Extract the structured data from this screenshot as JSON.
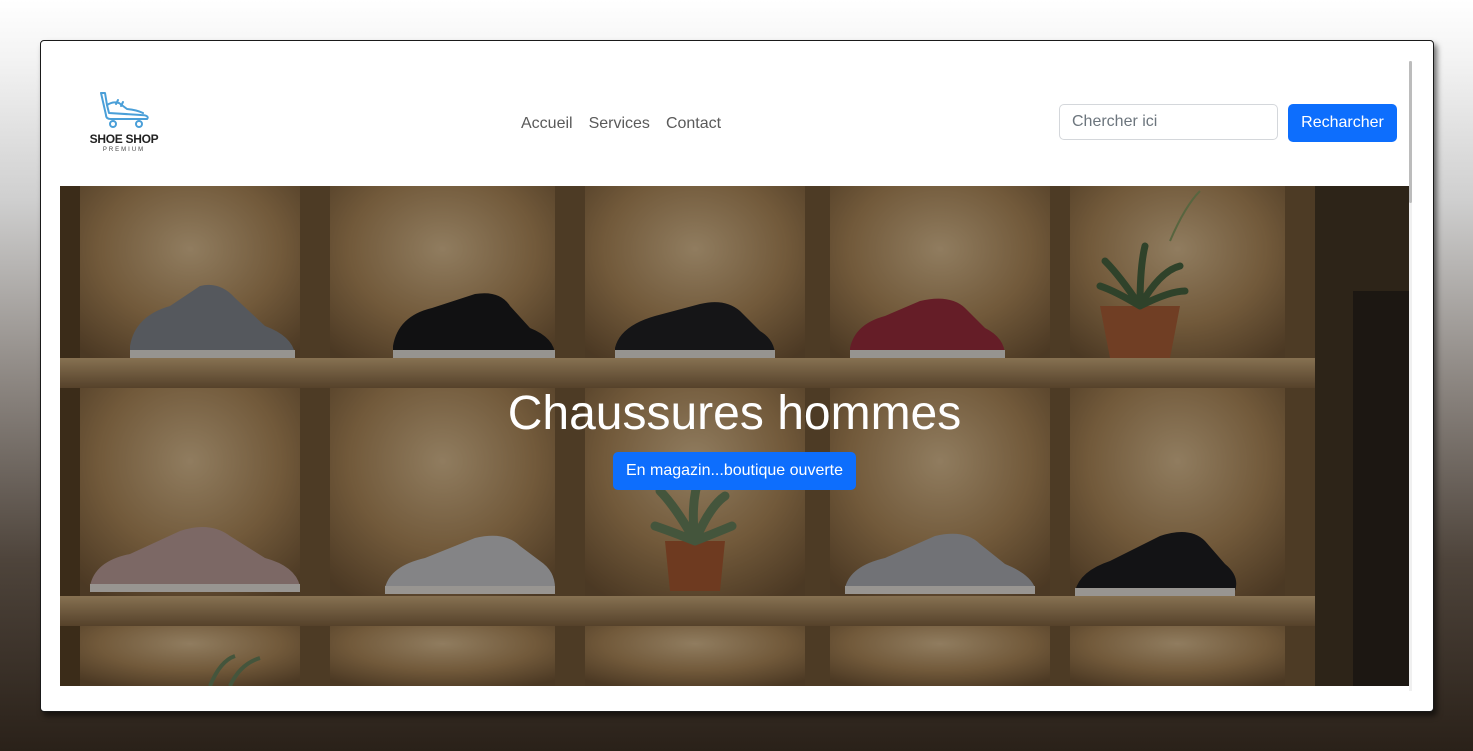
{
  "brand": {
    "name": "SHOE SHOP",
    "tagline": "PREMIUM",
    "logo_icon": "shoe-icon",
    "logo_color": "#4a9fd8"
  },
  "nav": {
    "items": [
      {
        "label": "Accueil"
      },
      {
        "label": "Services"
      },
      {
        "label": "Contact"
      }
    ]
  },
  "search": {
    "placeholder": "Chercher ici",
    "value": "",
    "button_label": "Recharcher"
  },
  "hero": {
    "title": "Chaussures hommes",
    "button_label": "En magazin...boutique ouverte"
  },
  "colors": {
    "primary": "#0d6efd",
    "nav_text": "#5a5a5a"
  }
}
